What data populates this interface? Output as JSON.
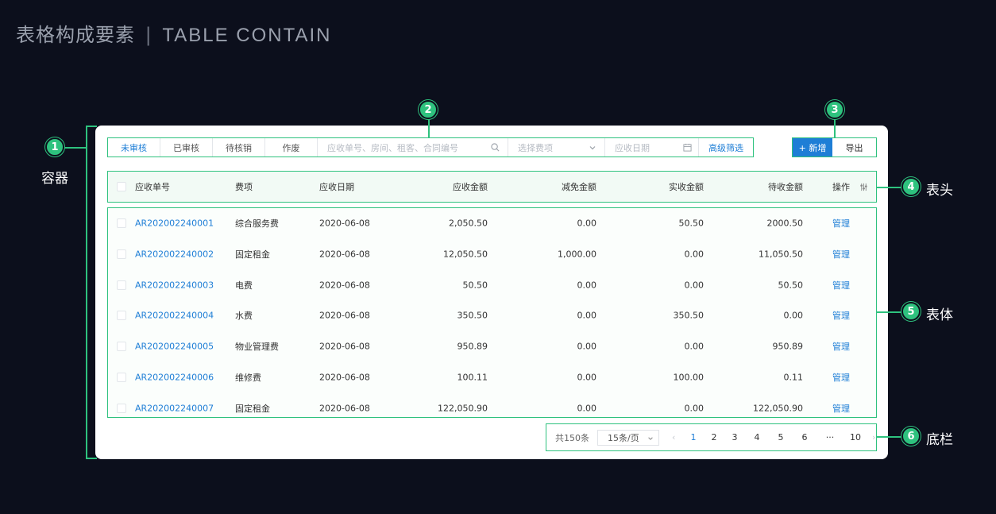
{
  "header": {
    "title_cn": "表格构成要素",
    "separator": "|",
    "title_en": "TABLE CONTAIN"
  },
  "toolbar": {
    "status_tabs": [
      {
        "label": "未审核",
        "active": true
      },
      {
        "label": "已审核",
        "active": false
      },
      {
        "label": "待核销",
        "active": false
      },
      {
        "label": "作废",
        "active": false
      }
    ],
    "search_placeholder": "应收单号、房间、租客、合同编号",
    "fee_placeholder": "选择费项",
    "date_placeholder": "应收日期",
    "advanced_filter": "高级筛选",
    "add_label": "+ 新增",
    "export_label": "导出"
  },
  "table": {
    "columns": [
      "应收单号",
      "费项",
      "应收日期",
      "应收金额",
      "减免金额",
      "实收金额",
      "待收金额",
      "操作"
    ],
    "rows": [
      [
        "AR202002240001",
        "综合服务费",
        "2020-06-08",
        "2,050.50",
        "0.00",
        "50.50",
        "2000.50",
        "管理"
      ],
      [
        "AR202002240002",
        "固定租金",
        "2020-06-08",
        "12,050.50",
        "1,000.00",
        "0.00",
        "11,050.50",
        "管理"
      ],
      [
        "AR202002240003",
        "电费",
        "2020-06-08",
        "50.50",
        "0.00",
        "0.00",
        "50.50",
        "管理"
      ],
      [
        "AR202002240004",
        "水费",
        "2020-06-08",
        "350.50",
        "0.00",
        "350.50",
        "0.00",
        "管理"
      ],
      [
        "AR202002240005",
        "物业管理费",
        "2020-06-08",
        "950.89",
        "0.00",
        "0.00",
        "950.89",
        "管理"
      ],
      [
        "AR202002240006",
        "维修费",
        "2020-06-08",
        "100.11",
        "0.00",
        "100.00",
        "0.11",
        "管理"
      ],
      [
        "AR202002240007",
        "固定租金",
        "2020-06-08",
        "122,050.90",
        "0.00",
        "0.00",
        "122,050.90",
        "管理"
      ]
    ]
  },
  "footer": {
    "total": "共150条",
    "page_size": "15条/页",
    "prev": "‹",
    "pages": [
      "1",
      "2",
      "3",
      "4",
      "5",
      "6",
      "···",
      "10"
    ],
    "current_page": "1",
    "next": "›"
  },
  "annotations": [
    {
      "num": "1",
      "label": "容器"
    },
    {
      "num": "2",
      "label": ""
    },
    {
      "num": "3",
      "label": ""
    },
    {
      "num": "4",
      "label": "表头"
    },
    {
      "num": "5",
      "label": "表体"
    },
    {
      "num": "6",
      "label": "底栏"
    }
  ],
  "colors": {
    "accent_green": "#2ec27e",
    "primary_blue": "#1e7ed6",
    "background": "#0c0f1c"
  }
}
